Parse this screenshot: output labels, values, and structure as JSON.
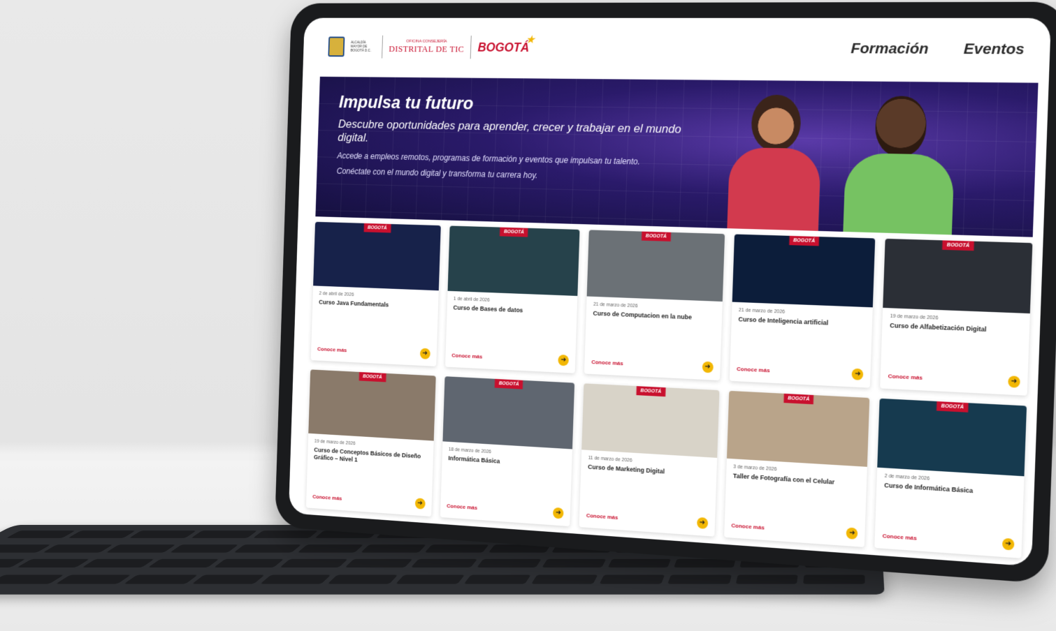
{
  "header": {
    "alcaldia": "ALCALDÍA MAYOR DE BOGOTÁ D.C.",
    "ofi_small": "OFICINA CONSEJERÍA",
    "ofi_big": "DISTRITAL DE TIC",
    "brand": "BOGOTÁ",
    "nav": [
      "Formación",
      "Eventos"
    ]
  },
  "hero": {
    "title": "Impulsa tu futuro",
    "subtitle": "Descubre oportunidades para aprender, crecer y trabajar en el mundo digital.",
    "p1": "Accede a empleos remotos, programas de formación y eventos que impulsan tu talento.",
    "p2": "Conéctate con el mundo digital y transforma tu carrera hoy."
  },
  "badge": "BOGOTÁ",
  "more_label": "Conoce más",
  "cards": [
    {
      "date": "2 de abril de 2026",
      "title": "Curso Java Fundamentals",
      "color": "#17224a"
    },
    {
      "date": "1 de abril de 2026",
      "title": "Curso de Bases de datos",
      "color": "#26424b"
    },
    {
      "date": "21 de marzo de 2026",
      "title": "Curso de Computacion en la nube",
      "color": "#6b7176"
    },
    {
      "date": "21 de marzo de 2026",
      "title": "Curso de Inteligencia artificial",
      "color": "#0c1d3a"
    },
    {
      "date": "19 de marzo de 2026",
      "title": "Curso de Alfabetización Digital",
      "color": "#2b2f36"
    },
    {
      "date": "19 de marzo de 2026",
      "title": "Curso de Conceptos Básicos de Diseño Gráfico – Nivel 1",
      "color": "#8a7a6a"
    },
    {
      "date": "18 de marzo de 2026",
      "title": "Informática Básica",
      "color": "#5f6670"
    },
    {
      "date": "11 de marzo de 2026",
      "title": "Curso de Marketing Digital",
      "color": "#d8d3c8"
    },
    {
      "date": "3 de marzo de 2026",
      "title": "Taller de Fotografía con el Celular",
      "color": "#b9a48a"
    },
    {
      "date": "2 de marzo de 2026",
      "title": "Curso de Informática Básica",
      "color": "#163a4f"
    }
  ]
}
